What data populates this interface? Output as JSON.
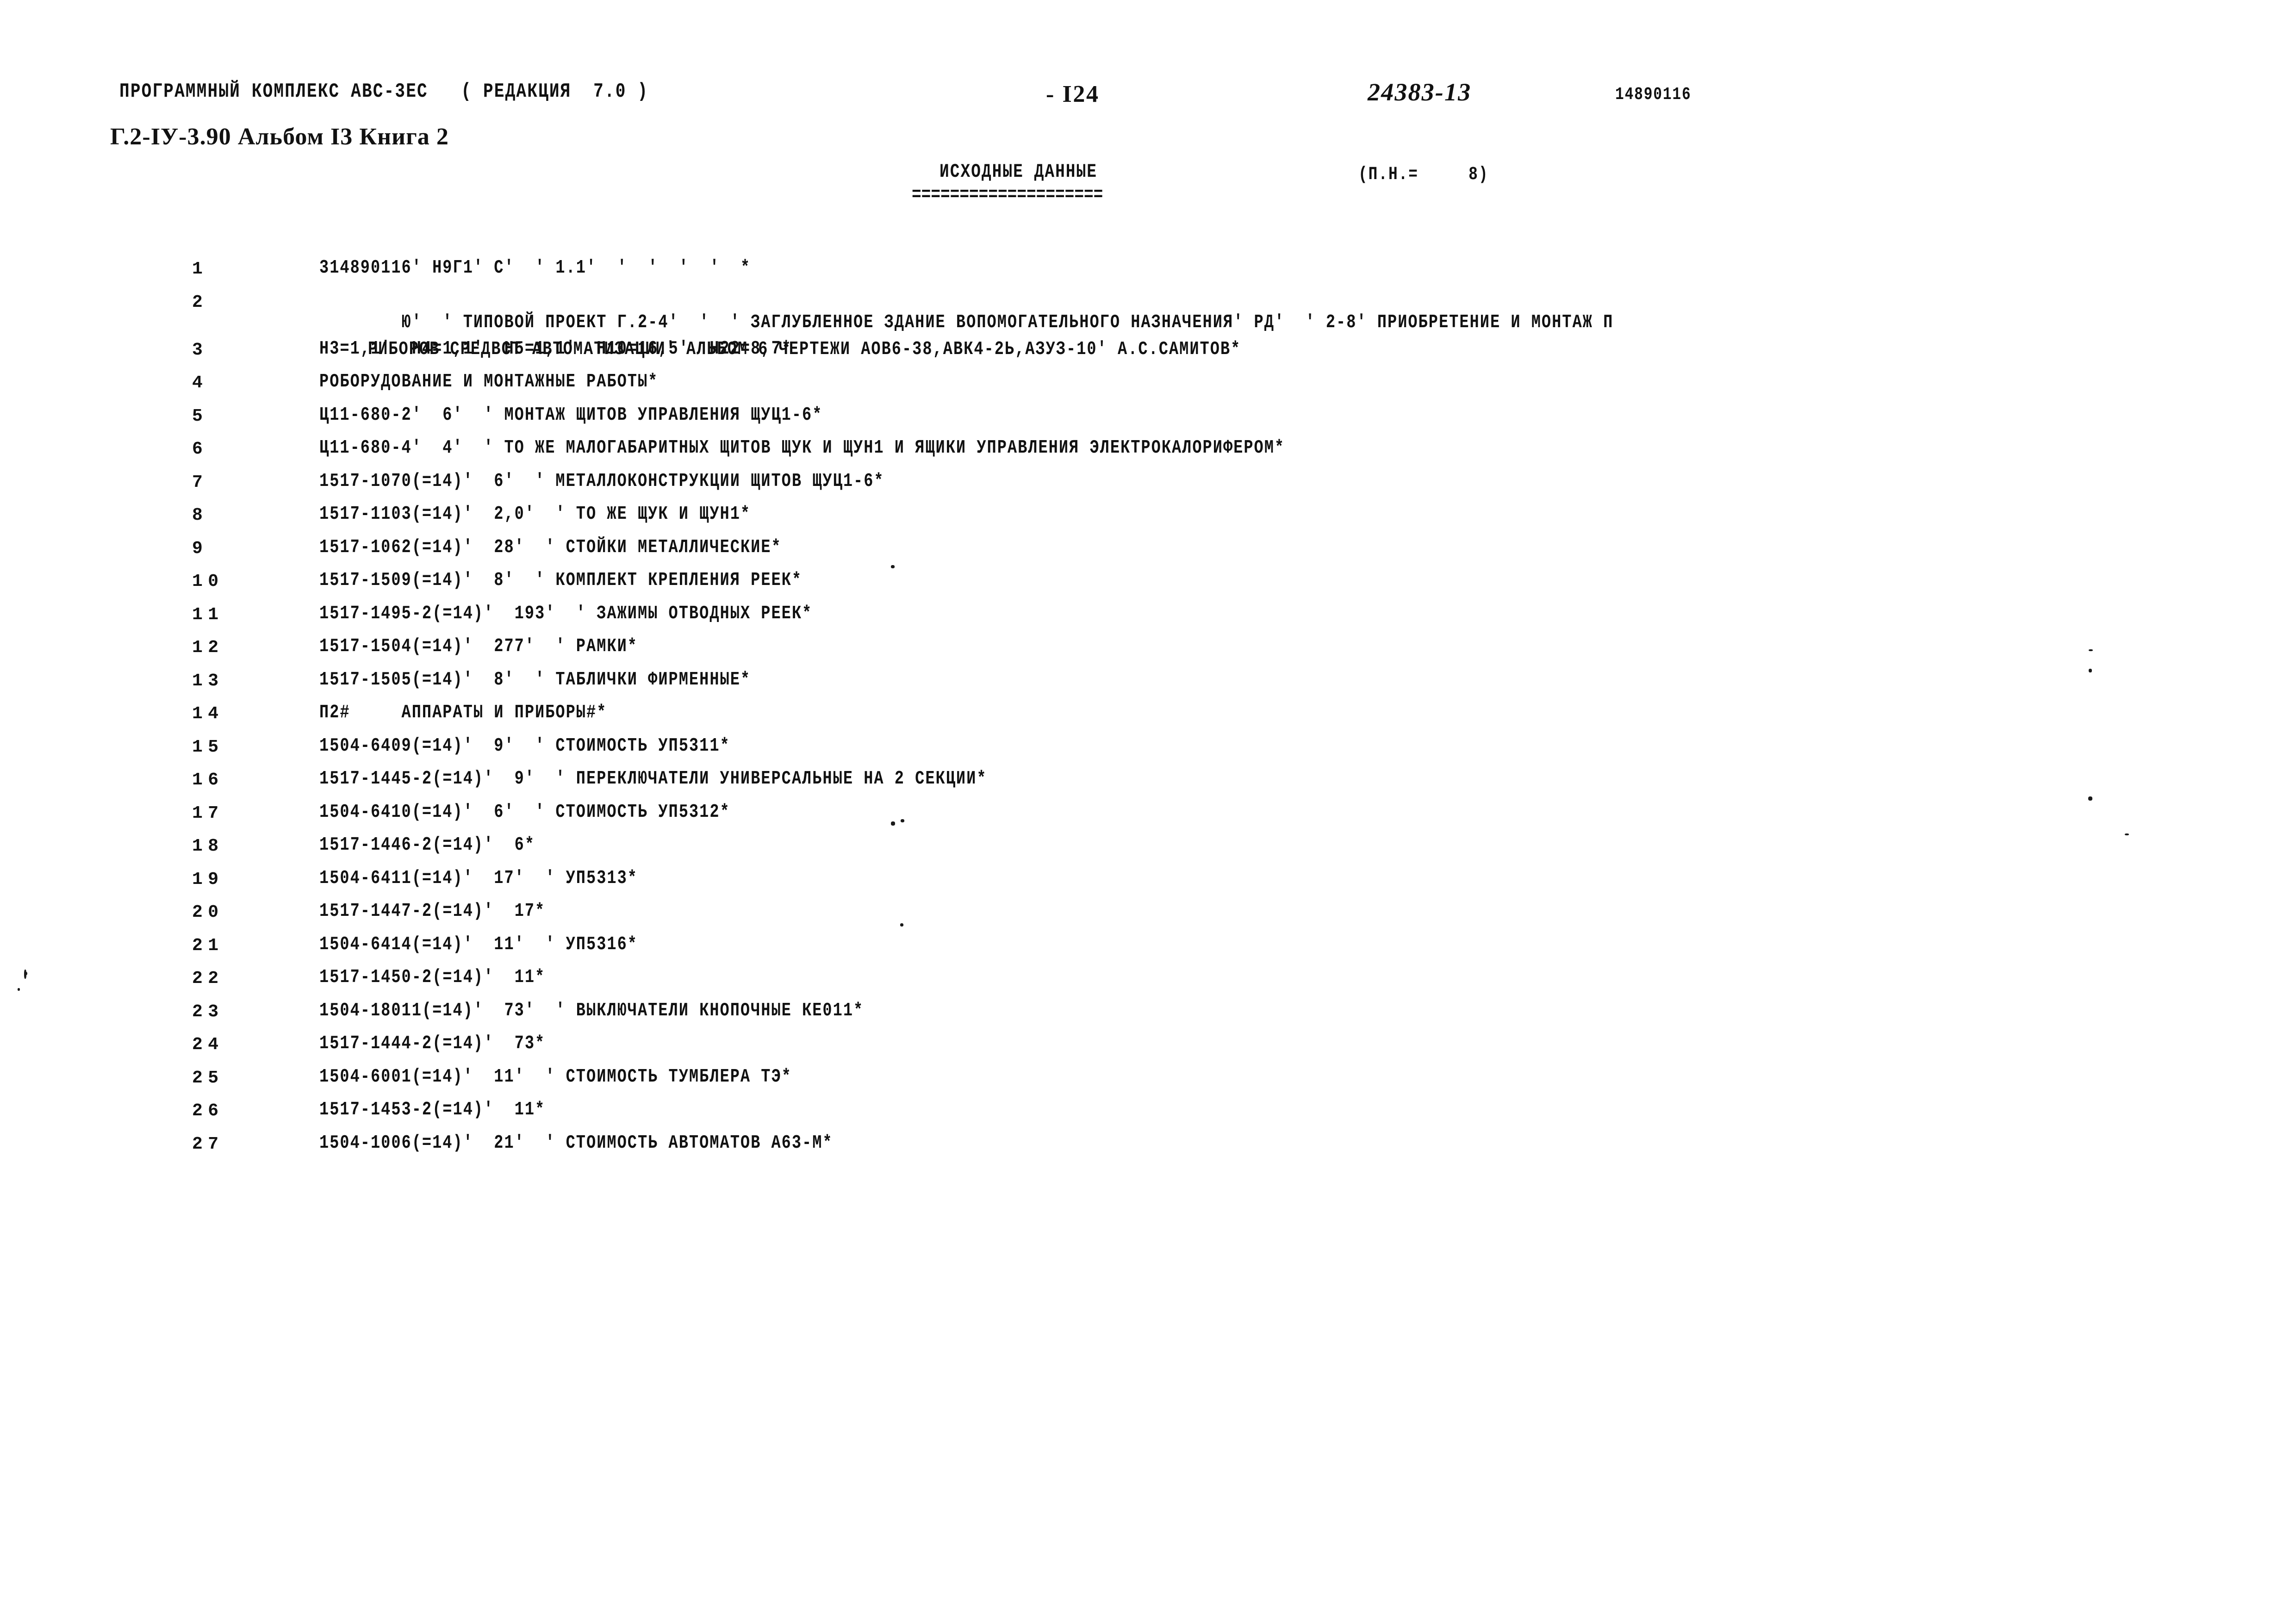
{
  "header": {
    "program_line": "ПРОГРАММНЫЙ КОМПЛЕКС АВС-3ЕС   ( РЕДАКЦИЯ  7.0 )",
    "album_line": "Г.2-IУ-3.90 Альбом I3 Книга 2",
    "page_number": "- I24",
    "document_number": "24383-13",
    "object_number": "14890116"
  },
  "title": {
    "main": "ИСХОДНЫЕ ДАННЫЕ",
    "rule": "====================",
    "pn_label": "(П.Н.=     8)"
  },
  "listing": {
    "rows": [
      {
        "no": "1",
        "text": "314890116' Н9Г1' С'  ' 1.1'  '  '  '  '  *"
      },
      {
        "no": "2",
        "text": "Ю'  ' ТИПОВОЙ ПРОЕКТ Г.2-4'  '  ' ЗАГЛУБЛЕННОЕ ЗДАНИЕ ВОПОМОГАТЕЛЬНОГО НАЗНАЧЕНИЯ' РД'  ' 2-8' ПРИОБРЕТЕНИЕ И МОНТАЖ П",
        "text2": "РИБОРОВ СРЕДВСТ АВТОМАТИЗАЦИИ' АЛЬБОМ 6 ЧЕРТЕЖИ АОВ6-38,АВК4-2Ь,АЗУЗ-10' А.С.САМИТОВ*"
      },
      {
        "no": "3",
        "text": "Н3=1,1'  Н4=1,1'  Н5=1,1'  Н10=16,5'  Н22=8,7*"
      },
      {
        "no": "4",
        "text": "РОБОРУДОВАНИЕ И МОНТАЖНЫЕ РАБОТЫ*"
      },
      {
        "no": "5",
        "text": "Ц11-680-2'  6'  ' МОНТАЖ ЩИТОВ УПРАВЛЕНИЯ ЩУЦ1-6*"
      },
      {
        "no": "6",
        "text": "Ц11-680-4'  4'  ' ТО ЖЕ МАЛОГАБАРИТНЫХ ЩИТОВ ЩУК И ЩУН1 И ЯЩИКИ УПРАВЛЕНИЯ ЭЛЕКТРОКАЛОРИФЕРОМ*"
      },
      {
        "no": "7",
        "text": "1517-1070(=14)'  6'  ' МЕТАЛЛОКОНСТРУКЦИИ ЩИТОВ ЩУЦ1-6*"
      },
      {
        "no": "8",
        "text": "1517-1103(=14)'  2,0'  ' ТО ЖЕ ЩУК И ЩУН1*"
      },
      {
        "no": "9",
        "text": "1517-1062(=14)'  28'  ' СТОЙКИ МЕТАЛЛИЧЕСКИЕ*"
      },
      {
        "no": "10",
        "text": "1517-1509(=14)'  8'  ' КОМПЛЕКТ КРЕПЛЕНИЯ РЕЕК*"
      },
      {
        "no": "11",
        "text": "1517-1495-2(=14)'  193'  ' ЗАЖИМЫ ОТВОДНЫХ РЕЕК*"
      },
      {
        "no": "12",
        "text": "1517-1504(=14)'  277'  ' РАМКИ*"
      },
      {
        "no": "13",
        "text": "1517-1505(=14)'  8'  ' ТАБЛИЧКИ ФИРМЕННЫЕ*"
      },
      {
        "no": "14",
        "text": "П2#     АППАРАТЫ И ПРИБОРЫ#*"
      },
      {
        "no": "15",
        "text": "1504-6409(=14)'  9'  ' СТОИМОСТЬ УП5311*"
      },
      {
        "no": "16",
        "text": "1517-1445-2(=14)'  9'  ' ПЕРЕКЛЮЧАТЕЛИ УНИВЕРСАЛЬНЫЕ НА 2 СЕКЦИИ*"
      },
      {
        "no": "17",
        "text": "1504-6410(=14)'  6'  ' СТОИМОСТЬ УП5312*"
      },
      {
        "no": "18",
        "text": "1517-1446-2(=14)'  6*"
      },
      {
        "no": "19",
        "text": "1504-6411(=14)'  17'  ' УП5313*"
      },
      {
        "no": "20",
        "text": "1517-1447-2(=14)'  17*"
      },
      {
        "no": "21",
        "text": "1504-6414(=14)'  11'  ' УП5316*"
      },
      {
        "no": "22",
        "text": "1517-1450-2(=14)'  11*"
      },
      {
        "no": "23",
        "text": "1504-18011(=14)'  73'  ' ВЫКЛЮЧАТЕЛИ КНОПОЧНЫЕ КЕ011*"
      },
      {
        "no": "24",
        "text": "1517-1444-2(=14)'  73*"
      },
      {
        "no": "25",
        "text": "1504-6001(=14)'  11'  ' СТОИМОСТЬ ТУМБЛЕРА ТЭ*"
      },
      {
        "no": "26",
        "text": "1517-1453-2(=14)'  11*"
      },
      {
        "no": "27",
        "text": "1504-1006(=14)'  21'  ' СТОИМОСТЬ АВТОМАТОВ А63-М*"
      }
    ]
  }
}
